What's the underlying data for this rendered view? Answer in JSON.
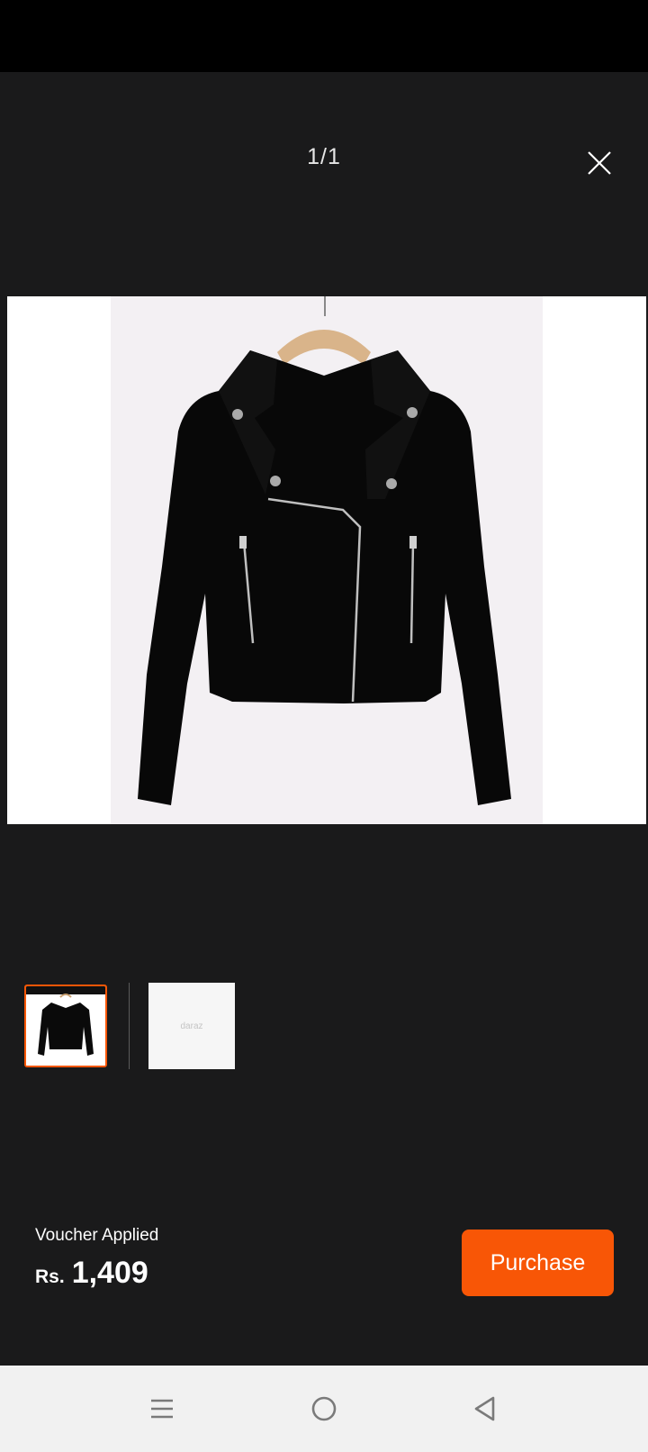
{
  "viewer": {
    "counter": "1/1",
    "close_icon": "close-icon",
    "main_image": "black-jacket-on-hanger"
  },
  "thumbnails": [
    {
      "image": "black-jacket-thumbnail",
      "selected": true
    },
    {
      "image": "placeholder-thumbnail",
      "text": "daraz",
      "selected": false
    }
  ],
  "footer": {
    "voucher_label": "Voucher Applied",
    "currency": "Rs.",
    "price": "1,409",
    "purchase_label": "Purchase"
  },
  "navigation": {
    "menu_icon": "menu-icon",
    "home_icon": "home-icon",
    "back_icon": "back-icon"
  },
  "colors": {
    "accent": "#f85606",
    "background": "#1a1a1b",
    "status_bar": "#000000",
    "nav_bar": "#f1f1f1"
  }
}
